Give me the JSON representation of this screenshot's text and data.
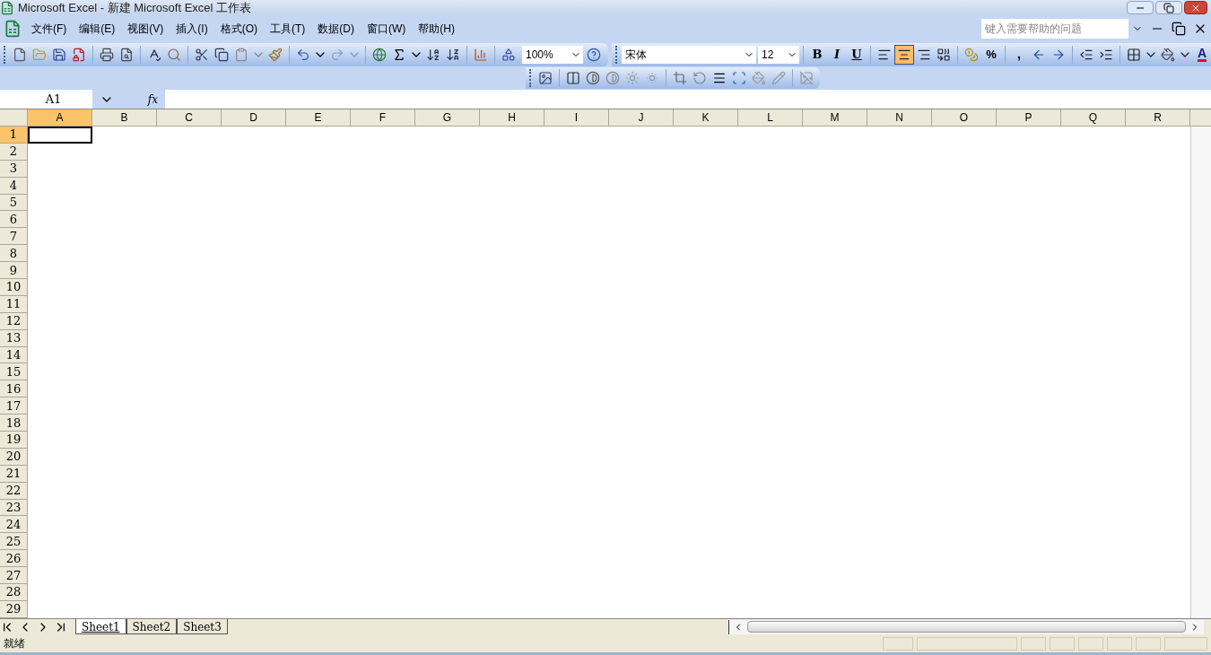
{
  "window": {
    "title": "Microsoft Excel - 新建 Microsoft Excel 工作表"
  },
  "menu": [
    {
      "label": "文件(F)"
    },
    {
      "label": "编辑(E)"
    },
    {
      "label": "视图(V)"
    },
    {
      "label": "插入(I)"
    },
    {
      "label": "格式(O)"
    },
    {
      "label": "工具(T)"
    },
    {
      "label": "数据(D)"
    },
    {
      "label": "窗口(W)"
    },
    {
      "label": "帮助(H)"
    }
  ],
  "help_search": {
    "placeholder": "键入需要帮助的问题"
  },
  "standard_toolbar": {
    "zoom": "100%"
  },
  "formatting_toolbar": {
    "font": "宋体",
    "size": "12",
    "buttons": [
      {
        "kind": "bold",
        "label": "B",
        "pressed": false
      },
      {
        "kind": "italic",
        "label": "I",
        "pressed": false
      },
      {
        "kind": "underline",
        "label": "U",
        "pressed": false
      },
      {
        "kind": "align-left",
        "pressed": false
      },
      {
        "kind": "align-center",
        "pressed": true
      },
      {
        "kind": "align-right",
        "pressed": false
      },
      {
        "kind": "merge",
        "pressed": false
      },
      {
        "kind": "currency",
        "pressed": false
      },
      {
        "kind": "percent",
        "label": "%",
        "pressed": false
      },
      {
        "kind": "comma",
        "label": ",",
        "pressed": false
      },
      {
        "kind": "decimal-increase",
        "pressed": false
      },
      {
        "kind": "decimal-decrease",
        "pressed": false
      },
      {
        "kind": "indent-decrease",
        "pressed": false
      },
      {
        "kind": "indent-increase",
        "pressed": false
      },
      {
        "kind": "borders",
        "pressed": false
      },
      {
        "kind": "fill-color",
        "pressed": false
      },
      {
        "kind": "font-color",
        "label": "A",
        "pressed": false
      }
    ]
  },
  "formula_bar": {
    "name_box": "A1",
    "fx": "fx"
  },
  "columns": [
    {
      "label": "A",
      "selected": true
    },
    {
      "label": "B",
      "selected": false
    },
    {
      "label": "C",
      "selected": false
    },
    {
      "label": "D",
      "selected": false
    },
    {
      "label": "E",
      "selected": false
    },
    {
      "label": "F",
      "selected": false
    },
    {
      "label": "G",
      "selected": false
    },
    {
      "label": "H",
      "selected": false
    },
    {
      "label": "I",
      "selected": false
    },
    {
      "label": "J",
      "selected": false
    },
    {
      "label": "K",
      "selected": false
    },
    {
      "label": "L",
      "selected": false
    },
    {
      "label": "M",
      "selected": false
    },
    {
      "label": "N",
      "selected": false
    },
    {
      "label": "O",
      "selected": false
    },
    {
      "label": "P",
      "selected": false
    },
    {
      "label": "Q",
      "selected": false
    },
    {
      "label": "R",
      "selected": false
    }
  ],
  "rows": [
    {
      "label": "1",
      "selected": true
    },
    {
      "label": "2",
      "selected": false
    },
    {
      "label": "3",
      "selected": false
    },
    {
      "label": "4",
      "selected": false
    },
    {
      "label": "5",
      "selected": false
    },
    {
      "label": "6",
      "selected": false
    },
    {
      "label": "7",
      "selected": false
    },
    {
      "label": "8",
      "selected": false
    },
    {
      "label": "9",
      "selected": false
    },
    {
      "label": "10",
      "selected": false
    },
    {
      "label": "11",
      "selected": false
    },
    {
      "label": "12",
      "selected": false
    },
    {
      "label": "13",
      "selected": false
    },
    {
      "label": "14",
      "selected": false
    },
    {
      "label": "15",
      "selected": false
    },
    {
      "label": "16",
      "selected": false
    },
    {
      "label": "17",
      "selected": false
    },
    {
      "label": "18",
      "selected": false
    },
    {
      "label": "19",
      "selected": false
    },
    {
      "label": "20",
      "selected": false
    },
    {
      "label": "21",
      "selected": false
    },
    {
      "label": "22",
      "selected": false
    },
    {
      "label": "23",
      "selected": false
    },
    {
      "label": "24",
      "selected": false
    },
    {
      "label": "25",
      "selected": false
    },
    {
      "label": "26",
      "selected": false
    },
    {
      "label": "27",
      "selected": false
    },
    {
      "label": "28",
      "selected": false
    },
    {
      "label": "29",
      "selected": false
    }
  ],
  "sheets": [
    {
      "label": "Sheet1",
      "selected": true
    },
    {
      "label": "Sheet2",
      "selected": false
    },
    {
      "label": "Sheet3",
      "selected": false
    }
  ],
  "status_bar": {
    "text": "就绪"
  }
}
